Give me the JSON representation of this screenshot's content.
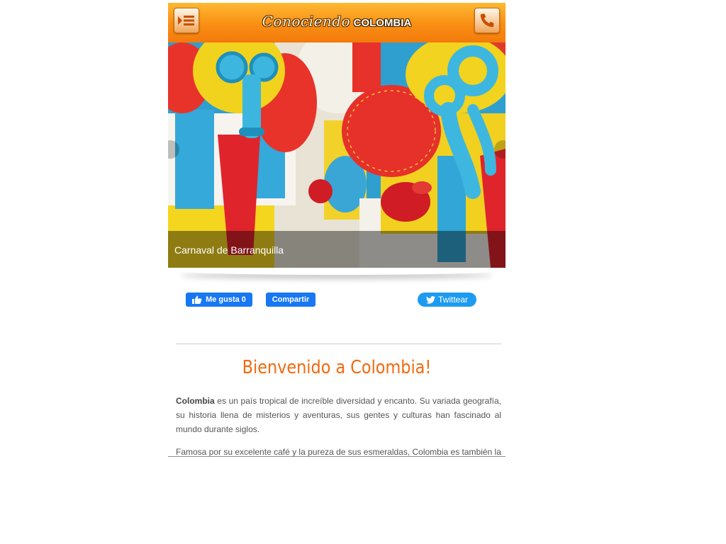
{
  "header": {
    "logo_script": "Conociendo",
    "logo_caps": "COLOMBIA",
    "menu_icon": "menu-list-icon",
    "phone_icon": "phone-icon"
  },
  "slider": {
    "caption": "Carnaval de Barranquilla"
  },
  "social": {
    "like_label": "Me gusta 0",
    "share_label": "Compartir",
    "tweet_label": "Twittear"
  },
  "content": {
    "title": "Bienvenido a Colombia!",
    "p1_bold": "Colombia",
    "p1_text": " es un país tropical de increíble diversidad y encanto. Su variada geografía, su historia llena de misterios y aventuras, sus gentes y culturas han fascinado al mundo durante siglos.",
    "p2_text": "Famosa por su excelente café y la pureza de sus esmeraldas, Colombia es también la"
  },
  "colors": {
    "header_orange": "#f98e13",
    "title_orange": "#f26a0e",
    "facebook_blue": "#1877f2",
    "twitter_blue": "#1d9bf0"
  }
}
